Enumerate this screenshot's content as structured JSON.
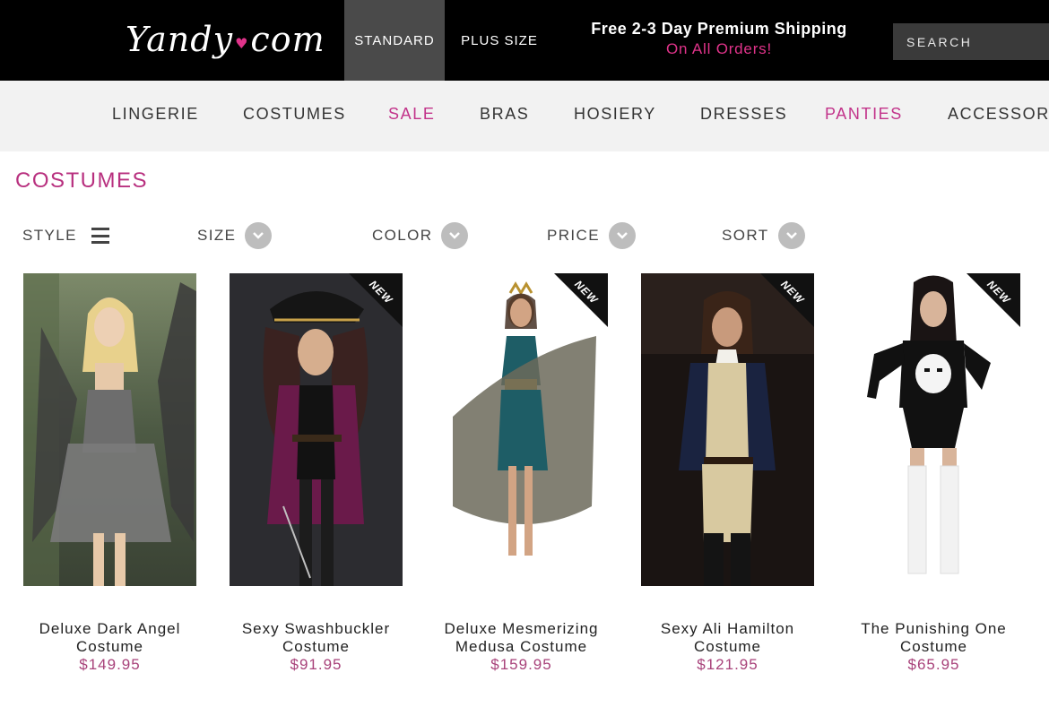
{
  "header": {
    "logo_text": "Yandy",
    "logo_suffix": "com",
    "size_tabs": [
      "STANDARD",
      "PLUS SIZE"
    ],
    "promo_line1": "Free 2-3 Day Premium Shipping",
    "promo_line2": "On All Orders!",
    "search_placeholder": "SEARCH"
  },
  "nav": {
    "items": [
      "LINGERIE",
      "COSTUMES",
      "SALE",
      "BRAS",
      "HOSIERY",
      "DRESSES",
      "PANTIES",
      "ACCESSORIES"
    ]
  },
  "page": {
    "title": "COSTUMES"
  },
  "filters": {
    "style": "STYLE",
    "size": "SIZE",
    "color": "COLOR",
    "price": "PRICE",
    "sort": "SORT"
  },
  "products": [
    {
      "name_line1": "Deluxe Dark Angel",
      "name_line2": "Costume",
      "price": "$149.95",
      "badge": ""
    },
    {
      "name_line1": "Sexy Swashbuckler",
      "name_line2": "Costume",
      "price": "$91.95",
      "badge": "NEW"
    },
    {
      "name_line1": "Deluxe Mesmerizing",
      "name_line2": "Medusa Costume",
      "price": "$159.95",
      "badge": "NEW"
    },
    {
      "name_line1": "Sexy Ali Hamilton",
      "name_line2": "Costume",
      "price": "$121.95",
      "badge": "NEW"
    },
    {
      "name_line1": "The Punishing One",
      "name_line2": "Costume",
      "price": "$65.95",
      "badge": "NEW"
    }
  ],
  "colors": {
    "brand_pink": "#e0338a",
    "price_color": "#a8427a",
    "title_color": "#b8307f"
  }
}
